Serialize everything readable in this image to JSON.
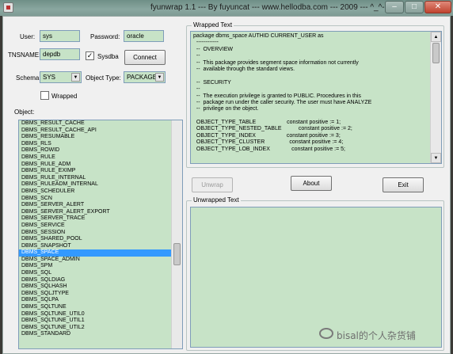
{
  "window": {
    "title": "fyunwrap 1.1 --- By fuyuncat --- www.hellodba.com --- 2009 --- ^_^---",
    "min_glyph": "–",
    "max_glyph": "□",
    "close_glyph": "✕"
  },
  "form": {
    "user_label": "User:",
    "user_value": "sys",
    "password_label": "Password:",
    "password_value": "oracle",
    "tnsname_label": "TNSNAME:",
    "tnsname_value": "depdb",
    "sysdba_label": "Sysdba",
    "sysdba_checked": "✓",
    "connect_label": "Connect",
    "schema_label": "Schema:",
    "schema_value": "SYS",
    "object_type_label": "Object Type:",
    "object_type_value": "PACKAGE",
    "wrapped_label": "Wrapped",
    "object_label": "Object:"
  },
  "object_list": [
    "DBMS_RESULT_CACHE",
    "DBMS_RESULT_CACHE_API",
    "DBMS_RESUMABLE",
    "DBMS_RLS",
    "DBMS_ROWID",
    "DBMS_RULE",
    "DBMS_RULE_ADM",
    "DBMS_RULE_EXIMP",
    "DBMS_RULE_INTERNAL",
    "DBMS_RULEADM_INTERNAL",
    "DBMS_SCHEDULER",
    "DBMS_SCN",
    "DBMS_SERVER_ALERT",
    "DBMS_SERVER_ALERT_EXPORT",
    "DBMS_SERVER_TRACE",
    "DBMS_SERVICE",
    "DBMS_SESSION",
    "DBMS_SHARED_POOL",
    "DBMS_SNAPSHOT",
    "DBMS_SPACE",
    "DBMS_SPACE_ADMIN",
    "DBMS_SPM",
    "DBMS_SQL",
    "DBMS_SQLDIAG",
    "DBMS_SQLHASH",
    "DBMS_SQLJTYPE",
    "DBMS_SQLPA",
    "DBMS_SQLTUNE",
    "DBMS_SQLTUNE_UTIL0",
    "DBMS_SQLTUNE_UTIL1",
    "DBMS_SQLTUNE_UTIL2",
    "DBMS_STANDARD"
  ],
  "selected_object": "DBMS_SPACE",
  "wrapped_text": {
    "title": "Wrapped Text",
    "lines": [
      "package dbms_space AUTHID CURRENT_USER as",
      "  ------------",
      "  --  OVERVIEW",
      "  --",
      "  --  This package provides segment space information not currently",
      "  --  available through the standard views.",
      "",
      "  --  SECURITY",
      "  --",
      "  --  The execution privilege is granted to PUBLIC. Procedures in this",
      "  --  package run under the caller security. The user must have ANALYZE",
      "  --  privilege on the object.",
      "",
      "  OBJECT_TYPE_TABLE                    constant positive := 1;",
      "  OBJECT_TYPE_NESTED_TABLE           constant positive := 2;",
      "  OBJECT_TYPE_INDEX                    constant positive := 3;",
      "  OBJECT_TYPE_CLUSTER                constant positive := 4;",
      "  OBJECT_TYPE_LOB_INDEX              constant positive := 5;"
    ]
  },
  "buttons": {
    "unwrap": "Unwrap",
    "about": "About",
    "exit": "Exit"
  },
  "unwrapped_text": {
    "title": "Unwrapped Text"
  },
  "watermark": "bisal的个人杂货铺"
}
